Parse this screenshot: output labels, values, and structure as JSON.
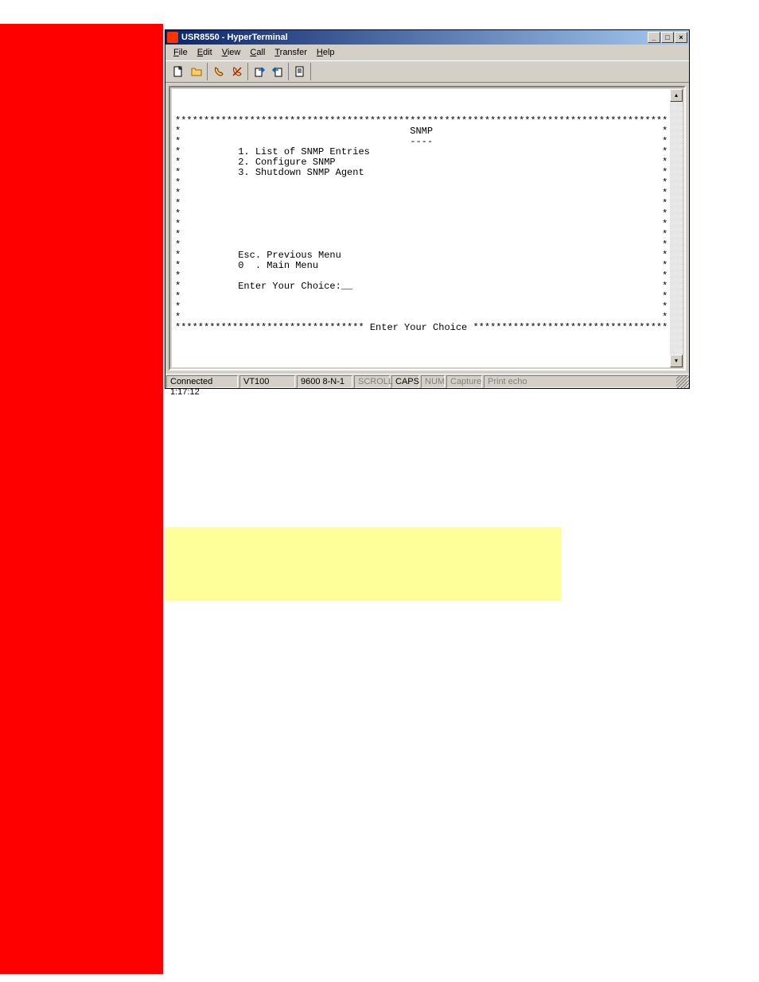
{
  "window": {
    "title": "USR8550 - HyperTerminal"
  },
  "menubar": {
    "items": [
      {
        "label": "File",
        "under": "F"
      },
      {
        "label": "Edit",
        "under": "E"
      },
      {
        "label": "View",
        "under": "V"
      },
      {
        "label": "Call",
        "under": "C"
      },
      {
        "label": "Transfer",
        "under": "T"
      },
      {
        "label": "Help",
        "under": "H"
      }
    ]
  },
  "toolbar_icons": {
    "new": "new-file-icon",
    "open": "open-folder-icon",
    "connect": "phone-connect-icon",
    "disconnect": "phone-disconnect-icon",
    "send": "send-icon",
    "receive": "receive-icon",
    "properties": "properties-icon"
  },
  "terminal": {
    "border_line": "**************************************************************************************",
    "header_title": "SNMP",
    "header_underline": "----",
    "menu_items": [
      "1. List of SNMP Entries",
      "2. Configure SNMP",
      "3. Shutdown SNMP Agent"
    ],
    "nav_items": [
      "Esc. Previous Menu",
      "0  . Main Menu"
    ],
    "prompt": "Enter Your Choice:__",
    "footer_label": "Enter Your Choice"
  },
  "statusbar": {
    "connected": "Connected 1:17:12",
    "emulation": "VT100",
    "settings": "9600 8-N-1",
    "scroll": "SCROLL",
    "caps": "CAPS",
    "num": "NUM",
    "capture": "Capture",
    "printecho": "Print echo"
  }
}
